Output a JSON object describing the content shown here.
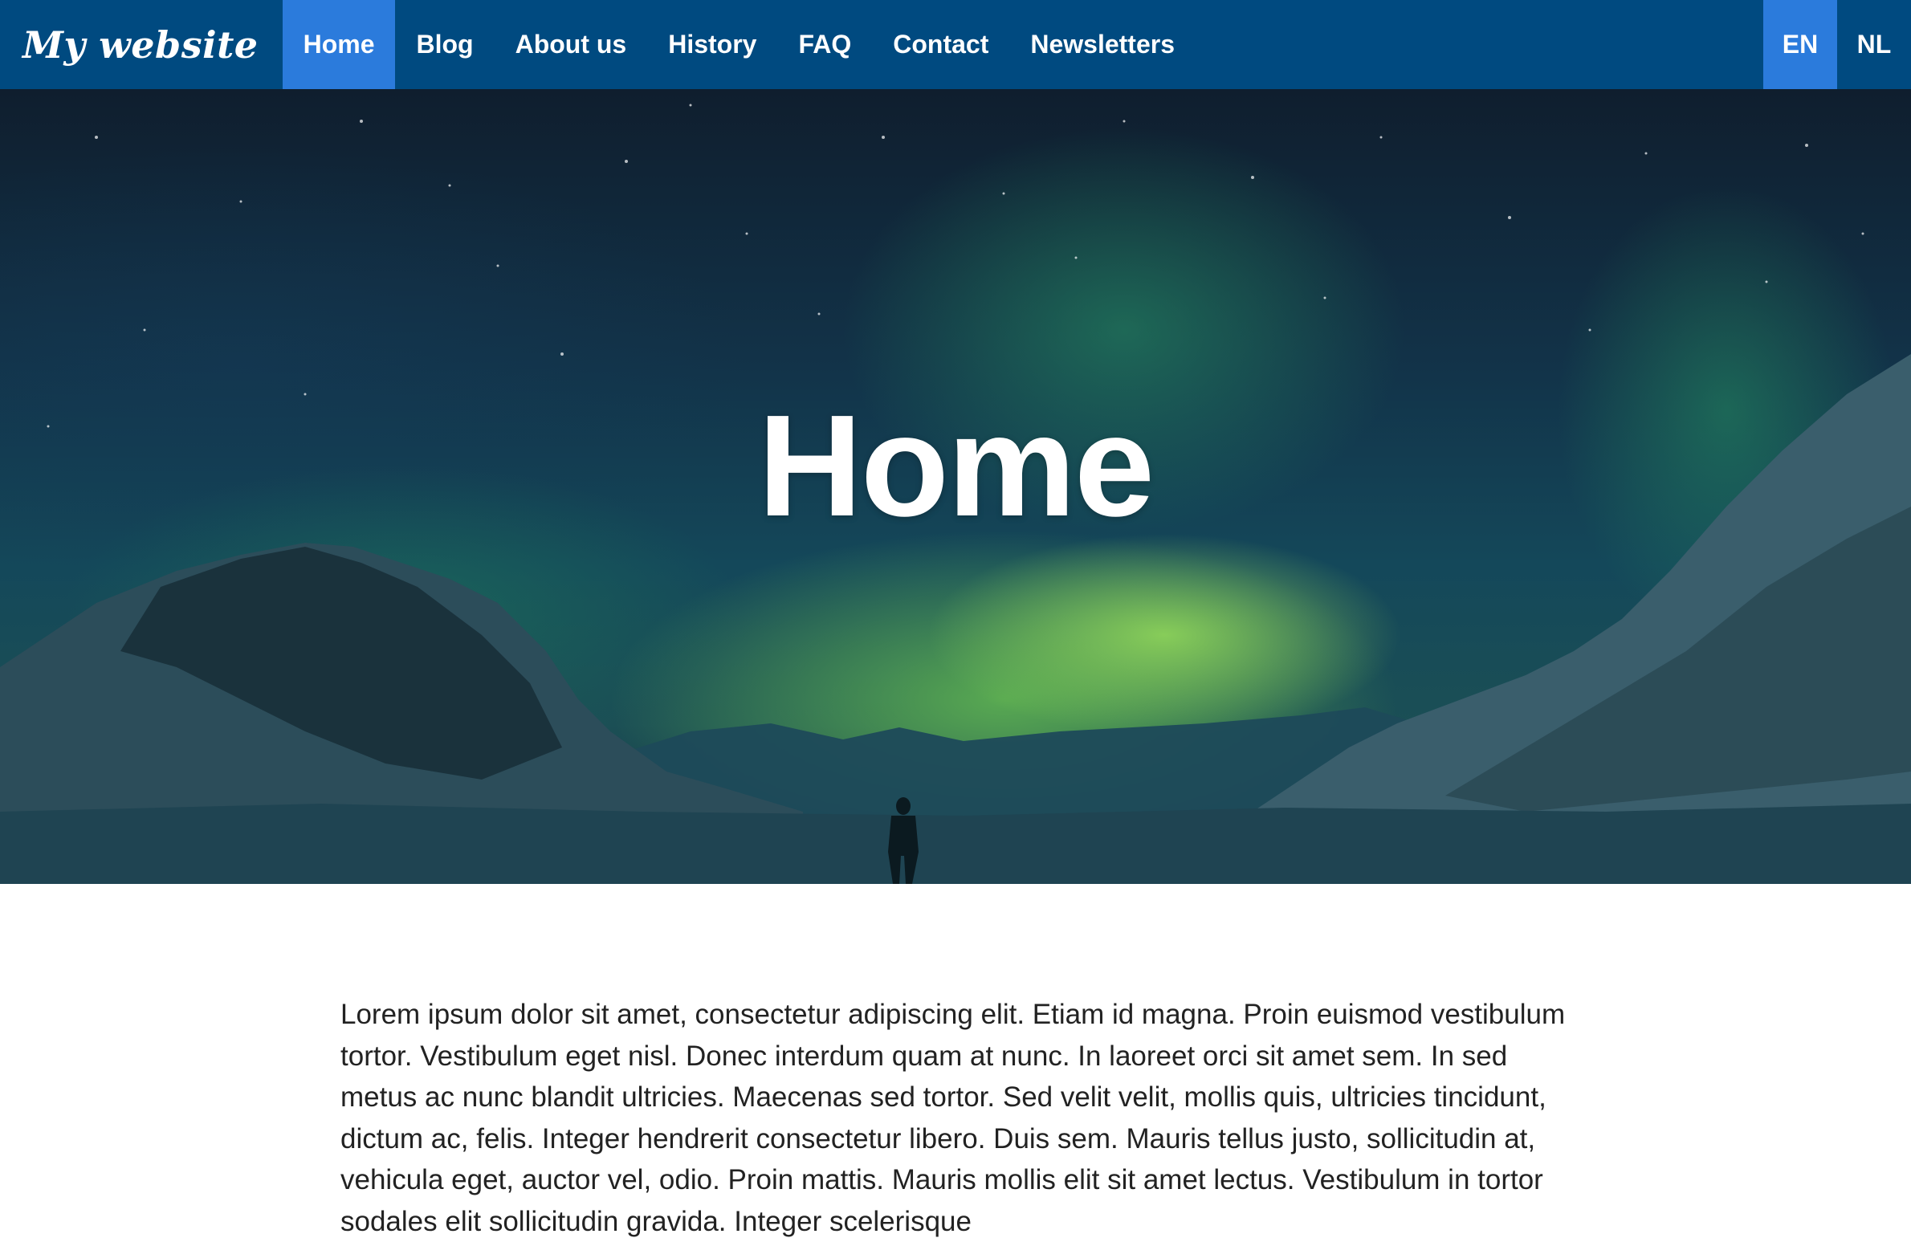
{
  "nav": {
    "brand": "My website",
    "items": [
      {
        "label": "Home",
        "active": true
      },
      {
        "label": "Blog",
        "active": false
      },
      {
        "label": "About us",
        "active": false
      },
      {
        "label": "History",
        "active": false
      },
      {
        "label": "FAQ",
        "active": false
      },
      {
        "label": "Contact",
        "active": false
      },
      {
        "label": "Newsletters",
        "active": false
      }
    ],
    "languages": [
      {
        "label": "EN",
        "active": true
      },
      {
        "label": "NL",
        "active": false
      }
    ]
  },
  "hero": {
    "title": "Home"
  },
  "content": {
    "paragraph": "Lorem ipsum dolor sit amet, consectetur adipiscing elit. Etiam id magna. Proin euismod vestibulum tortor. Vestibulum eget nisl. Donec interdum quam at nunc. In laoreet orci sit amet sem. In sed metus ac nunc blandit ultricies. Maecenas sed tortor. Sed velit velit, mollis quis, ultricies tincidunt, dictum ac, felis. Integer hendrerit consectetur libero. Duis sem. Mauris tellus justo, sollicitudin at, vehicula eget, auctor vel, odio. Proin mattis. Mauris mollis elit sit amet lectus. Vestibulum in tortor sodales elit sollicitudin gravida. Integer scelerisque"
  },
  "colors": {
    "navbar": "#004a80",
    "active": "#2b7bdc",
    "text": "#222222"
  }
}
